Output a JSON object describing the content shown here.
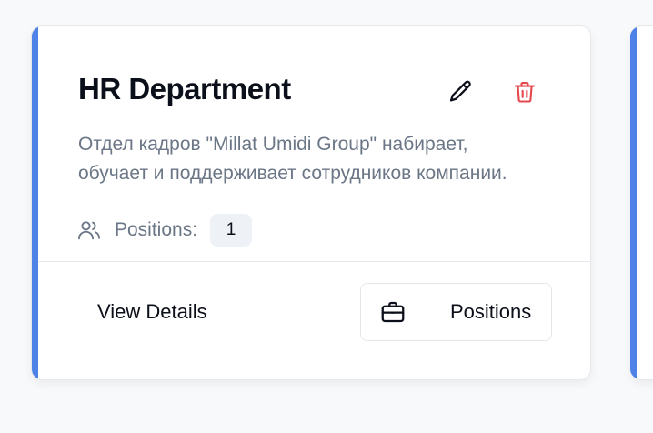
{
  "card": {
    "title": "HR Department",
    "description": "Отдел кадров \"Millat Umidi Group\" набирает, обучает и поддерживает сотрудников компании.",
    "positions_label": "Positions:",
    "positions_count": "1",
    "view_details_label": "View Details",
    "positions_button_label": "Positions",
    "accent_color": "#4f82e6",
    "delete_color": "#e5484d",
    "icons": {
      "edit": "pencil-icon",
      "delete": "trash-icon",
      "positions": "users-icon",
      "positions_button": "briefcase-icon"
    }
  }
}
